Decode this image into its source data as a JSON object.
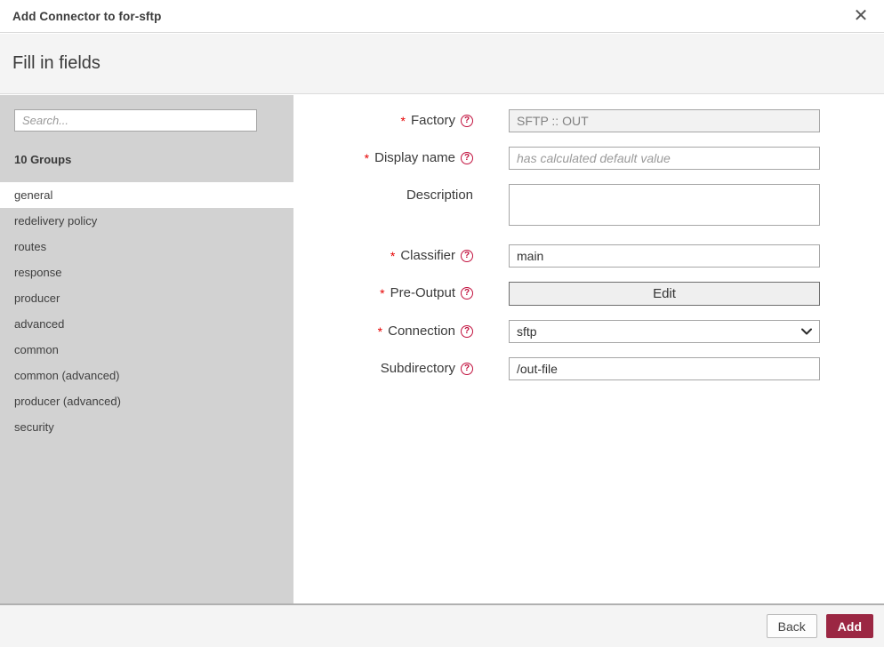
{
  "modal": {
    "title": "Add Connector to for-sftp",
    "close_glyph": "✕",
    "heading": "Fill in fields"
  },
  "sidebar": {
    "search_placeholder": "Search...",
    "groups_count_label": "10 Groups",
    "items": [
      {
        "label": "general",
        "selected": true
      },
      {
        "label": "redelivery policy",
        "selected": false
      },
      {
        "label": "routes",
        "selected": false
      },
      {
        "label": "response",
        "selected": false
      },
      {
        "label": "producer",
        "selected": false
      },
      {
        "label": "advanced",
        "selected": false
      },
      {
        "label": "common",
        "selected": false
      },
      {
        "label": "common (advanced)",
        "selected": false
      },
      {
        "label": "producer (advanced)",
        "selected": false
      },
      {
        "label": "security",
        "selected": false
      }
    ]
  },
  "form": {
    "required_marker": "*",
    "help_glyph": "?",
    "fields": [
      {
        "label": "Factory",
        "value": "SFTP :: OUT"
      },
      {
        "label": "Display name",
        "placeholder": "has calculated default value"
      },
      {
        "label": "Description",
        "value": ""
      },
      {
        "label": "Classifier",
        "value": "main"
      },
      {
        "label": "Pre-Output",
        "button_label": "Edit"
      },
      {
        "label": "Connection",
        "value": "sftp"
      },
      {
        "label": "Subdirectory",
        "value": "/out-file"
      }
    ]
  },
  "footer": {
    "back_label": "Back",
    "add_label": "Add"
  },
  "colors": {
    "accent": "#9b2743",
    "help_icon": "#c1103d",
    "required_asterisk": "#e60000",
    "sidebar_bg": "#d2d2d2",
    "panel_bg": "#f4f4f4"
  }
}
